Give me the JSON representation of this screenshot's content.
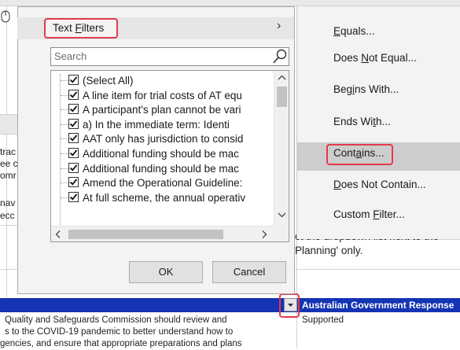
{
  "background": {
    "left_fragments": [
      "trac",
      "ee c",
      "omr",
      "nav",
      "ecc"
    ],
    "right_texts": [
      "ct the dropdown list next to the",
      "Planning' only."
    ],
    "header_cell": "Australian Government Response",
    "row_left_lines": [
      "Quality and Safeguards Commission should review and",
      "s to the COVID-19 pandemic to better understand how to",
      "gencies, and ensure that appropriate preparations and plans"
    ],
    "row_right": "Supported"
  },
  "filter_menu": {
    "text_filters_label": "Text Filters",
    "text_filters_accel": "F",
    "submenu_arrow": "›",
    "search_placeholder": "Search",
    "items": [
      {
        "label": "(Select All)",
        "checked": true
      },
      {
        "label": "A line item for trial costs of AT equ",
        "checked": true
      },
      {
        "label": "A participant's plan cannot be vari",
        "checked": true
      },
      {
        "label": "a)    In the immediate term:  Identi",
        "checked": true
      },
      {
        "label": "AAT only has jurisdiction to consid",
        "checked": true
      },
      {
        "label": "Additional funding should be mac",
        "checked": true
      },
      {
        "label": "Additional funding should be mac",
        "checked": true
      },
      {
        "label": "Amend the Operational Guideline:",
        "checked": true
      },
      {
        "label": "At full scheme, the annual operativ",
        "checked": true
      }
    ],
    "ok_label": "OK",
    "cancel_label": "Cancel"
  },
  "submenu": {
    "items": [
      {
        "label": "Equals...",
        "accel": "E"
      },
      {
        "label": "Does Not Equal...",
        "accel": "N"
      },
      {
        "label": "Begins With...",
        "accel": "i"
      },
      {
        "label": "Ends With...",
        "accel": "t"
      },
      {
        "label": "Contains...",
        "accel": "a",
        "highlighted": true
      },
      {
        "label": "Does Not Contain...",
        "accel": "D"
      },
      {
        "label": "Custom Filter...",
        "accel": "F"
      }
    ]
  },
  "colors": {
    "highlight_outline": "#e23a4e",
    "header_blue": "#1434b4",
    "menu_background": "#f3f3f3"
  }
}
